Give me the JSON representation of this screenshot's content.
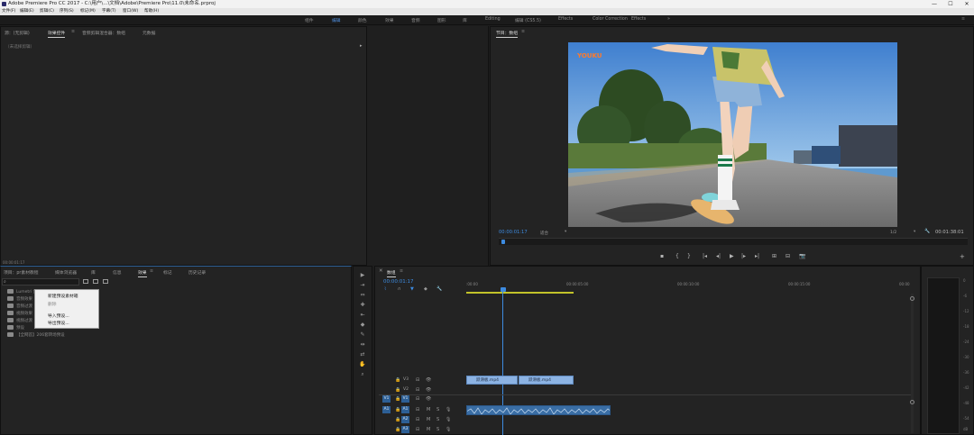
{
  "titlebar": {
    "title": "Adobe Premiere Pro CC 2017 - C:\\用户\\...\\文档\\Adobe\\Premiere Pro\\11.0\\未命名.prproj",
    "minimize": "—",
    "maximize": "☐",
    "close": "✕"
  },
  "menus": [
    "文件(F)",
    "编辑(E)",
    "剪辑(C)",
    "序列(S)",
    "标记(M)",
    "字幕(T)",
    "窗口(W)",
    "帮助(H)"
  ],
  "workspaces": {
    "items": [
      "组件",
      "编辑",
      "颜色",
      "效果",
      "音频",
      "图形",
      "库",
      "Editing",
      "编辑 (CS5.5)",
      "Effects",
      "Color Correction",
      "Effects"
    ],
    "more": "»",
    "menu": "≡"
  },
  "source_panel": {
    "tabs": [
      "源：(无剪辑)",
      "效果控件",
      "音频剪辑混合器：数组",
      "元数据"
    ],
    "tab_menu": "≡",
    "subtitle": "（未选择剪辑）",
    "timecode": "00:00:01:17",
    "expand": "▸"
  },
  "program_panel": {
    "title": "节目：数组",
    "title_menu": "≡",
    "watermark": "YOUKU",
    "timecode": "00:00:01:17",
    "fit": "适合",
    "fit_arrow": "▾",
    "quality": "1/2",
    "quality_arrow": "▾",
    "duration": "00:01:38:01",
    "wrench": "🔧",
    "controls": [
      "▪",
      "{",
      "}",
      "|◂",
      "◂|",
      "▶",
      "|▸",
      "▸|",
      "⊞",
      "⊟",
      "📷"
    ],
    "add": "+"
  },
  "project_panel": {
    "tabs": [
      "项目：pr素材教程",
      "媒体浏览器",
      "库",
      "信息",
      "效果",
      "标记",
      "历史记录"
    ],
    "tab_menu": "≡",
    "more": "»",
    "search_icon": "⌕",
    "folders": [
      "Lumetri 预设",
      "音频效果",
      "音频过渡",
      "视频效果",
      "视频过渡",
      "预设",
      "【全网首】206套转场预设"
    ],
    "context_menu": [
      "新建预设素材箱",
      "删除",
      "导入预设...",
      "导出预设..."
    ]
  },
  "timeline": {
    "title": "数组",
    "close": "✕",
    "menu": "≡",
    "timecode": "00:00:01:17",
    "ruler": [
      ":00:00",
      "00:00:05:00",
      "00:00:10:00",
      "00:00:15:00",
      "00:00:20:00",
      "00:00"
    ],
    "video_tracks": [
      "V3",
      "V2",
      "V1"
    ],
    "audio_tracks": [
      "A1",
      "A2",
      "A3"
    ],
    "source_v": "V1",
    "source_a": "A1",
    "lock_icon": "🔒",
    "sync_icon": "⊟",
    "eye_icon": "👁",
    "mute": "M",
    "solo": "S",
    "mic_icon": "🎙",
    "clips": [
      "跃滑板.mp4",
      "跃滑板.mp4"
    ],
    "meter_scale": [
      "0",
      "-6",
      "-12",
      "-18",
      "-24",
      "-30",
      "-36",
      "-42",
      "-48",
      "-54",
      "dB"
    ],
    "tools": [
      "▶",
      "⇥",
      "⇔",
      "✚",
      "⇤",
      "◆",
      "✎",
      "⇹",
      "⇄",
      "⬥",
      "✋",
      "⌕"
    ]
  },
  "colors": {
    "accent": "#3d8be0",
    "clip_video": "#8cb3e3",
    "clip_audio": "#3a6ea5",
    "work_area": "#c2c32a"
  }
}
